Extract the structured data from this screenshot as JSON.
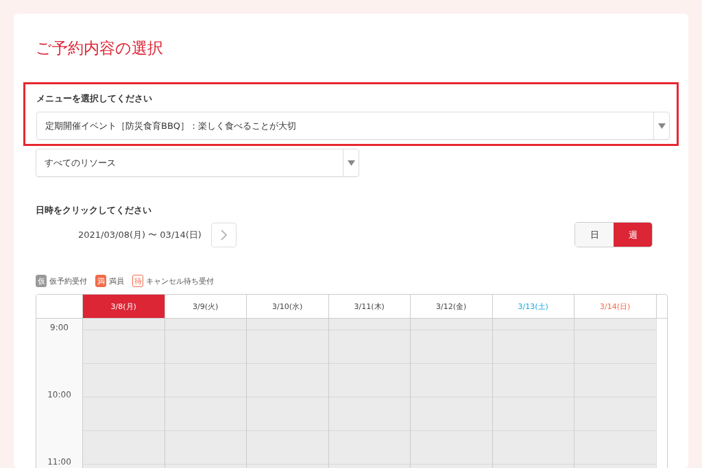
{
  "title": "ご予約内容の選択",
  "menu": {
    "label": "メニューを選択してください",
    "value": "定期開催イベント［防災食育BBQ］：楽しく食べることが大切",
    "highlighted": true
  },
  "resource": {
    "value": "すべてのリソース"
  },
  "schedule_label": "日時をクリックしてください",
  "date_range": "2021/03/08(月) 〜 03/14(日)",
  "view_tabs": [
    {
      "label": "日",
      "selected": false
    },
    {
      "label": "週",
      "selected": true
    }
  ],
  "legend": [
    {
      "mark": "仮",
      "label": "仮予約受付",
      "kind": "filled",
      "color": "#999999"
    },
    {
      "mark": "満",
      "label": "満員",
      "kind": "filled",
      "color": "#f26b4a"
    },
    {
      "mark": "待",
      "label": "キャンセル待ち受付",
      "kind": "outline",
      "color": "#f26b4a"
    }
  ],
  "days": [
    {
      "label": "3/8(月)",
      "kind": "weekday",
      "selected": true
    },
    {
      "label": "3/9(火)",
      "kind": "weekday",
      "selected": false
    },
    {
      "label": "3/10(水)",
      "kind": "weekday",
      "selected": false
    },
    {
      "label": "3/11(木)",
      "kind": "weekday",
      "selected": false
    },
    {
      "label": "3/12(金)",
      "kind": "weekday",
      "selected": false
    },
    {
      "label": "3/13(土)",
      "kind": "saturday",
      "selected": false
    },
    {
      "label": "3/14(日)",
      "kind": "sunday",
      "selected": false
    }
  ],
  "times": [
    "9:00",
    "10:00",
    "11:00"
  ]
}
